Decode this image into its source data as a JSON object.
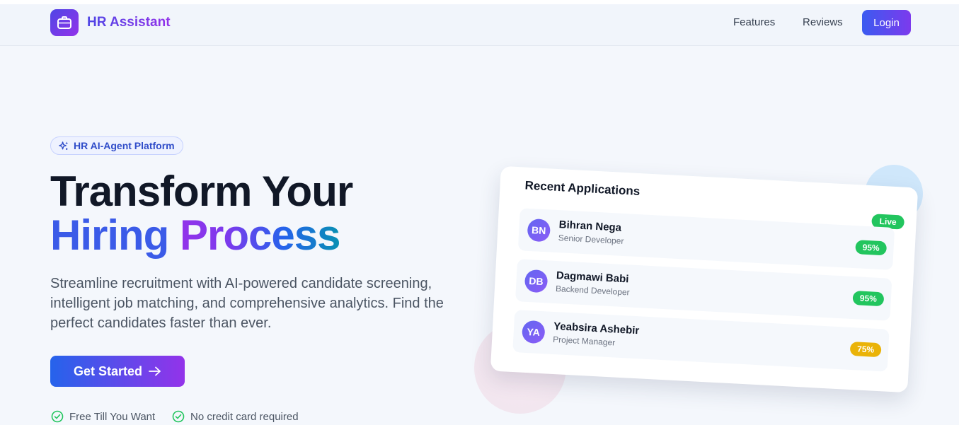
{
  "nav": {
    "brand": "HR Assistant",
    "links": [
      "Features",
      "Reviews"
    ],
    "login": "Login"
  },
  "hero": {
    "badge": "HR AI-Agent Platform",
    "headline_line1": "Transform Your",
    "headline_word_a": "Hiring",
    "headline_word_b": "Process",
    "subtitle": "Streamline recruitment with AI-powered candidate screening, intelligent job matching, and comprehensive analytics. Find the perfect candidates faster than ever.",
    "cta": "Get Started",
    "perks": [
      "Free Till You Want",
      "No credit card required"
    ]
  },
  "card": {
    "title": "Recent Applications",
    "status": "Live",
    "applications": [
      {
        "initials": "BN",
        "name": "Bihran Nega",
        "role": "Senior Developer",
        "score": "95%",
        "score_color": "#22c55e"
      },
      {
        "initials": "DB",
        "name": "Dagmawi Babi",
        "role": "Backend Developer",
        "score": "95%",
        "score_color": "#22c55e"
      },
      {
        "initials": "YA",
        "name": "Yeabsira Ashebir",
        "role": "Project Manager",
        "score": "75%",
        "score_color": "#eab308"
      }
    ]
  },
  "colors": {
    "accent_blue": "#3b5be8",
    "accent_purple": "#9333ea",
    "success": "#22c55e",
    "warning": "#eab308"
  },
  "icons": {
    "logo": "briefcase-icon",
    "badge": "sparkles-icon",
    "cta": "arrow-right-icon",
    "perk": "check-circle-icon"
  }
}
